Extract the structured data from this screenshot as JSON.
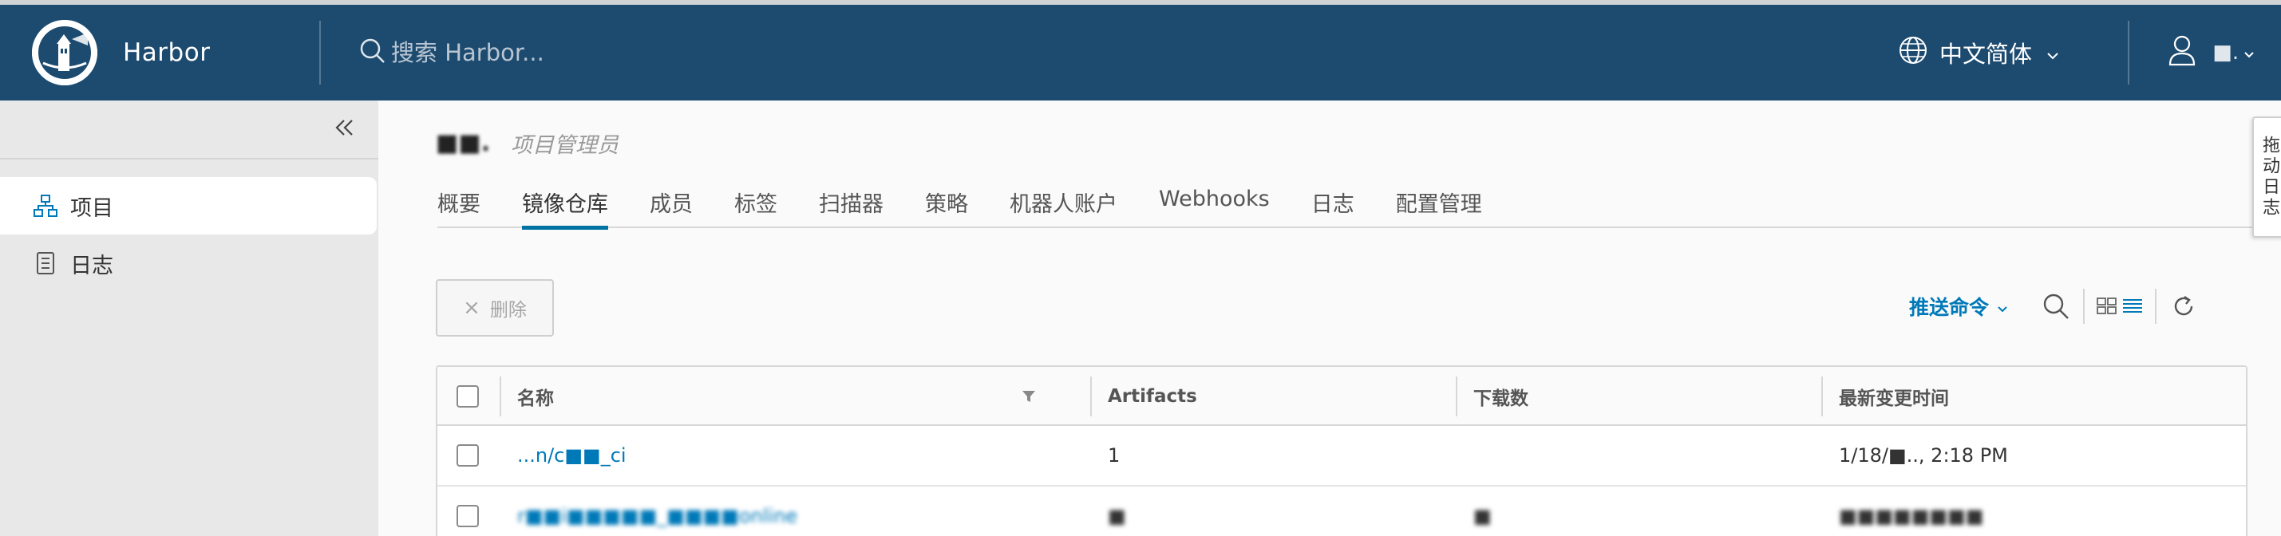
{
  "header": {
    "brand_name": "Harbor",
    "search_placeholder": "搜索 Harbor...",
    "language": "中文简体",
    "user_name": " ■."
  },
  "sidebar": {
    "items": [
      {
        "label": "项目",
        "icon": "project-icon",
        "active": true
      },
      {
        "label": "日志",
        "icon": "log-icon",
        "active": false
      }
    ]
  },
  "project": {
    "name": "■■.",
    "role": "项目管理员"
  },
  "tabs": [
    {
      "label": "概要",
      "active": false
    },
    {
      "label": "镜像仓库",
      "active": true
    },
    {
      "label": "成员",
      "active": false
    },
    {
      "label": "标签",
      "active": false
    },
    {
      "label": "扫描器",
      "active": false
    },
    {
      "label": "策略",
      "active": false
    },
    {
      "label": "机器人账户",
      "active": false
    },
    {
      "label": "Webhooks",
      "active": false
    },
    {
      "label": "日志",
      "active": false
    },
    {
      "label": "配置管理",
      "active": false
    }
  ],
  "toolbar": {
    "delete_label": "删除",
    "push_command_label": "推送命令"
  },
  "table": {
    "headers": {
      "name": "名称",
      "artifacts": "Artifacts",
      "pulls": "下载数",
      "updated": "最新变更时间"
    },
    "rows": [
      {
        "name": "...n/c■■_ci",
        "artifacts": "1",
        "pulls": "",
        "updated": "1/18/■.., 2:18 PM"
      },
      {
        "name": "r■■i■■■■■_■■■■online",
        "artifacts": "■",
        "pulls": "■",
        "updated": "■■■■■■■■"
      }
    ]
  },
  "side_tab": {
    "label": "拖动日志"
  },
  "colors": {
    "header_bg": "#1d4b70",
    "accent": "#0072a3",
    "link": "#0079b8",
    "sidebar_bg": "#e8e8e8"
  }
}
